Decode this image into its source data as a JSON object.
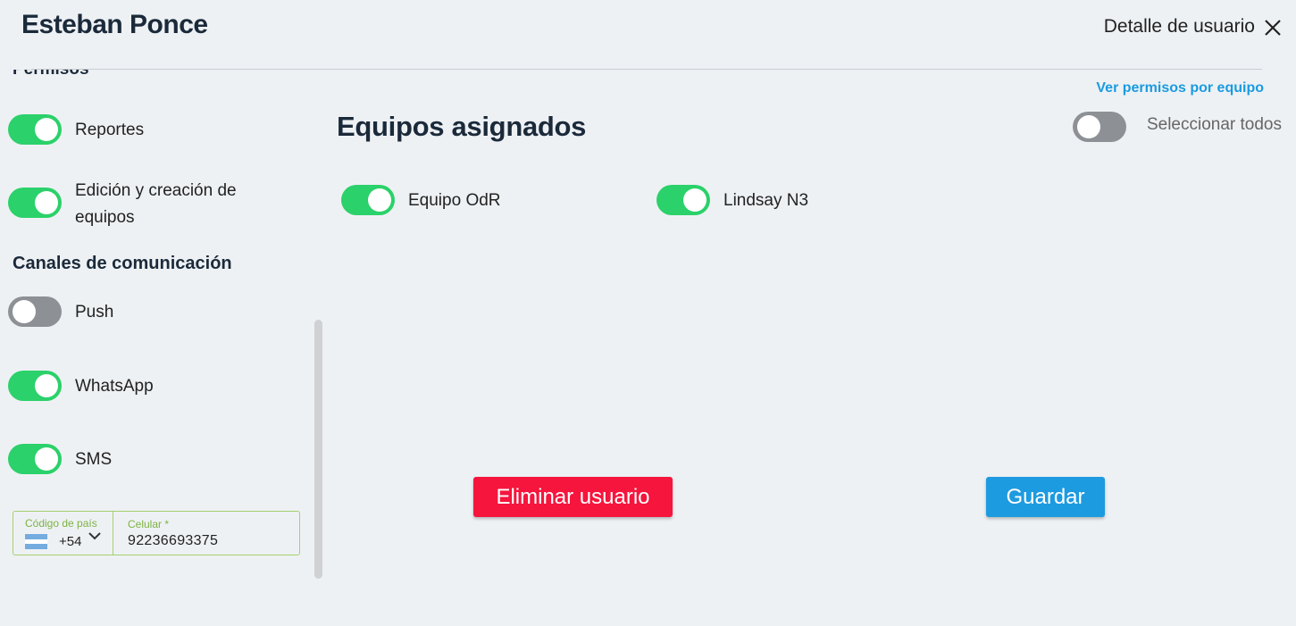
{
  "header": {
    "user_name": "Esteban Ponce",
    "detail_title": "Detalle de usuario",
    "close_icon": "close-icon"
  },
  "permissions": {
    "section_title": "Permisos",
    "view_by_team_link": "Ver permisos por equipo",
    "items": [
      {
        "label": "Reportes",
        "enabled": true
      },
      {
        "label_line1": "Edición y creación de",
        "label_line2": "equipos",
        "enabled": true
      }
    ]
  },
  "channels": {
    "section_title": "Canales de comunicación",
    "items": [
      {
        "label": "Push",
        "enabled": false
      },
      {
        "label": "WhatsApp",
        "enabled": true
      },
      {
        "label": "SMS",
        "enabled": true
      }
    ]
  },
  "phone": {
    "country_code_label": "Código de país",
    "country_code_value": "+54",
    "country_flag": "argentina-flag-icon",
    "cellphone_label": "Celular *",
    "cellphone_value": "92236693375"
  },
  "teams": {
    "title": "Equipos asignados",
    "select_all_label": "Seleccionar todos",
    "select_all_enabled": false,
    "items": [
      {
        "label": "Equipo OdR",
        "enabled": true
      },
      {
        "label": "Lindsay N3",
        "enabled": true
      }
    ]
  },
  "actions": {
    "delete_label": "Eliminar usuario",
    "save_label": "Guardar"
  },
  "colors": {
    "toggle_on": "#2bd16a",
    "toggle_off": "#8d9196",
    "link": "#1a9be0",
    "delete_button": "#f5153d",
    "save_button": "#1d9be0",
    "field_border": "#a3d16c"
  }
}
